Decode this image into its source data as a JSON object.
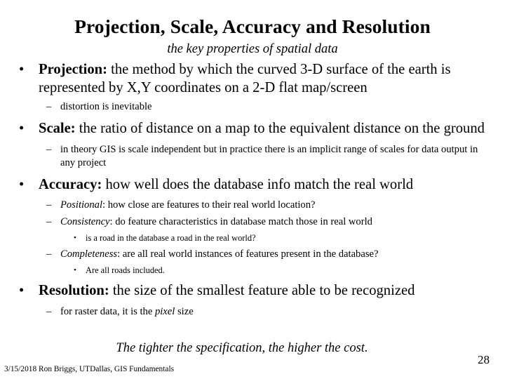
{
  "slide": {
    "title": "Projection, Scale, Accuracy and Resolution",
    "subtitle": "the key properties of spatial data",
    "bullet_glyph_l1": "•",
    "bullet_glyph_l2": "–",
    "bullet_glyph_l3": "•",
    "tagline": "The tighter the specification, the higher the cost.",
    "credit": "3/15/2018 Ron Briggs, UTDallas, GIS Fundamentals",
    "page_number": "28",
    "text_color": "#000000",
    "background_color": "#ffffff"
  },
  "content": {
    "projection": {
      "lead": "Projection:",
      "rest": " the method by which the curved 3-D surface of the earth is represented by X,Y coordinates on a 2-D flat map/screen",
      "sub1": "distortion is inevitable"
    },
    "scale": {
      "lead": "Scale:",
      "rest": " the ratio of distance on a map to the equivalent distance on the ground",
      "sub1": "in theory GIS is scale independent but in practice there is an implicit range  of scales for data output in any project"
    },
    "accuracy": {
      "lead": "Accuracy:",
      "rest": " how well does the database info match the real world",
      "positional_em": "Positional",
      "positional_rest": ": how close are features to their real world location?",
      "consistency_em": "Consistency",
      "consistency_rest": ": do feature characteristics in database match those in real world",
      "consistency_sub": "is a road in the database a road in the real world?",
      "completeness_em": "Completeness",
      "completeness_rest": ": are all real world instances of features present in the database?",
      "completeness_sub": "Are all roads included."
    },
    "resolution": {
      "lead": "Resolution:",
      "rest": " the size of the smallest feature able to be recognized",
      "sub1_before": "for raster data, it is the ",
      "sub1_em": "pixel",
      "sub1_after": " size"
    }
  }
}
